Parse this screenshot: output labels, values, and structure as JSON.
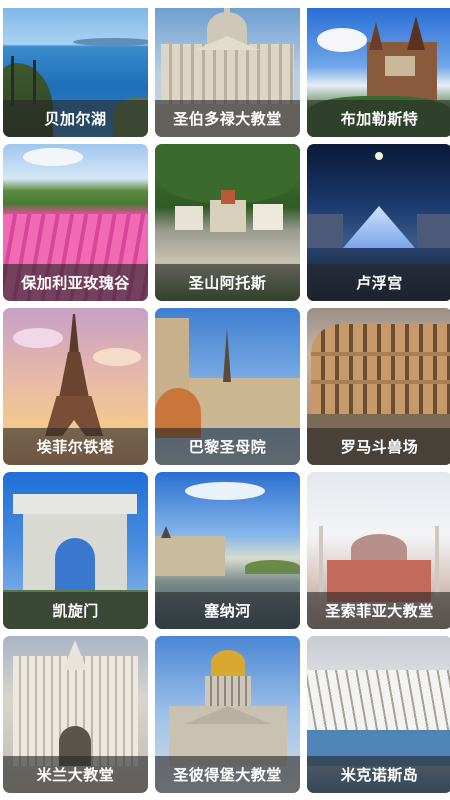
{
  "destinations": [
    {
      "name": "贝加尔湖",
      "image_icon": "baikal-lake-photo"
    },
    {
      "name": "圣伯多禄大教堂",
      "image_icon": "st-peters-basilica-photo"
    },
    {
      "name": "布加勒斯特",
      "image_icon": "bucharest-castle-photo"
    },
    {
      "name": "保加利亚玫瑰谷",
      "image_icon": "rose-valley-photo"
    },
    {
      "name": "圣山阿托斯",
      "image_icon": "mount-athos-photo"
    },
    {
      "name": "卢浮宫",
      "image_icon": "louvre-pyramid-photo"
    },
    {
      "name": "埃菲尔铁塔",
      "image_icon": "eiffel-tower-photo"
    },
    {
      "name": "巴黎圣母院",
      "image_icon": "notre-dame-photo"
    },
    {
      "name": "罗马斗兽场",
      "image_icon": "colosseum-photo"
    },
    {
      "name": "凯旋门",
      "image_icon": "triumphal-arch-photo"
    },
    {
      "name": "塞纳河",
      "image_icon": "seine-river-photo"
    },
    {
      "name": "圣索菲亚大教堂",
      "image_icon": "hagia-sophia-photo"
    },
    {
      "name": "米兰大教堂",
      "image_icon": "milan-cathedral-photo"
    },
    {
      "name": "圣彼得堡大教堂",
      "image_icon": "st-isaacs-cathedral-photo"
    },
    {
      "name": "米克诺斯岛",
      "image_icon": "mykonos-island-photo"
    }
  ]
}
